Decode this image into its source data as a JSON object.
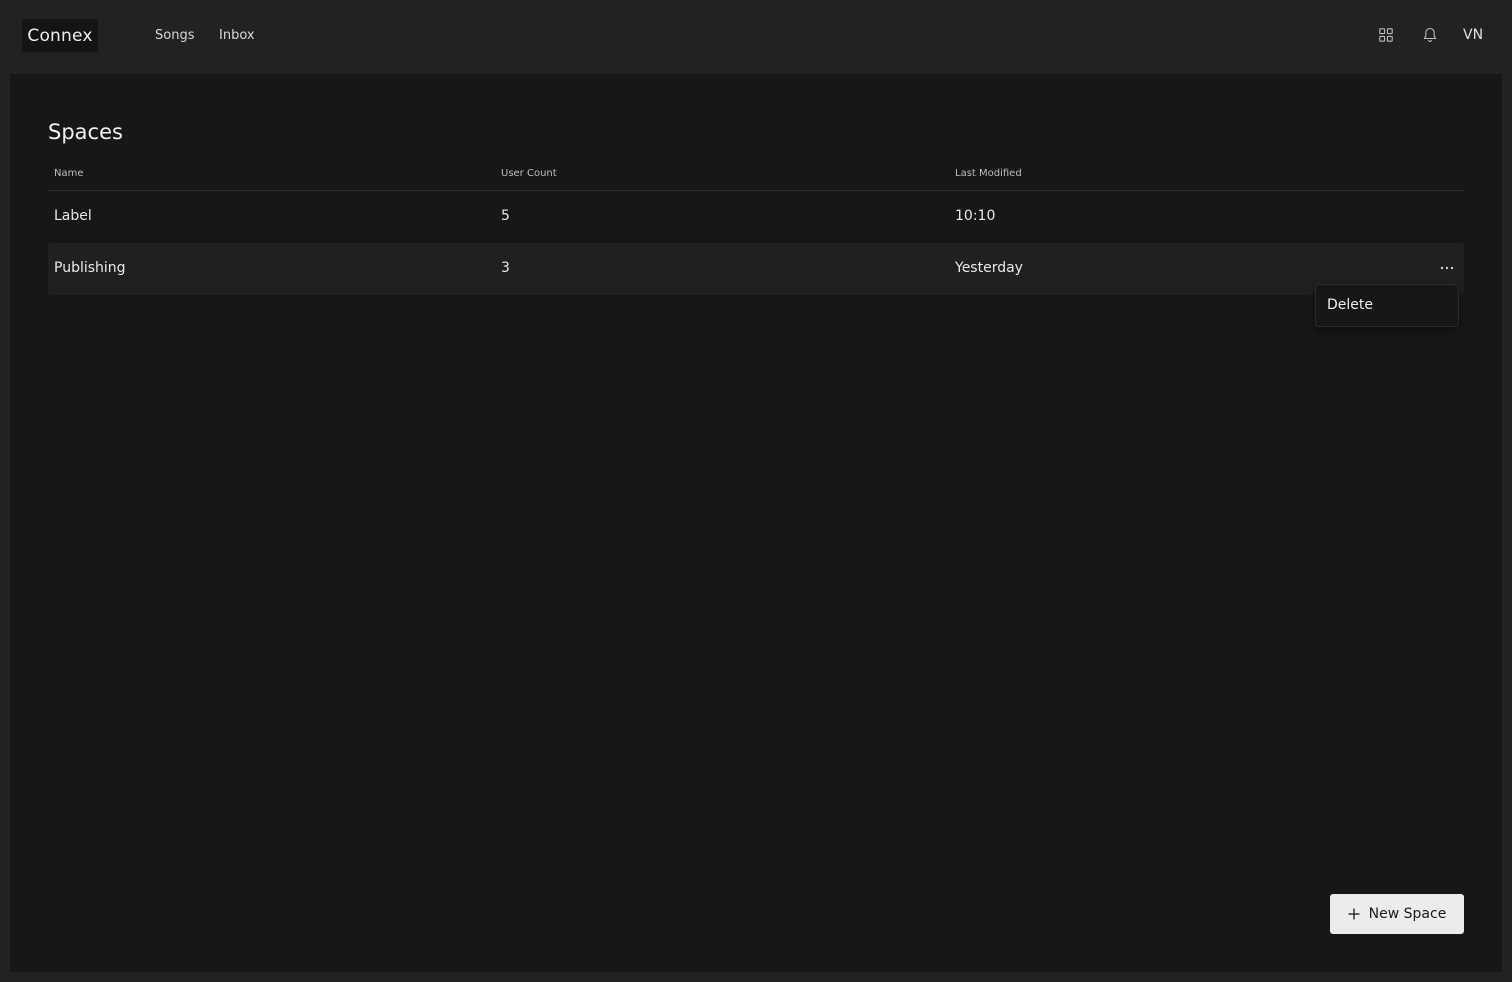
{
  "app": {
    "logo": "Connex"
  },
  "nav": {
    "songs": "Songs",
    "inbox": "Inbox"
  },
  "header": {
    "apps_icon": "grid-icon",
    "notifications_icon": "bell-icon",
    "avatar_initials": "VN"
  },
  "page": {
    "title": "Spaces"
  },
  "table": {
    "headers": {
      "name": "Name",
      "user_count": "User Count",
      "last_modified": "Last Modified"
    },
    "rows": [
      {
        "name": "Label",
        "user_count": "5",
        "last_modified": "10:10"
      },
      {
        "name": "Publishing",
        "user_count": "3",
        "last_modified": "Yesterday"
      }
    ]
  },
  "row_menu": {
    "delete_label": "Delete",
    "more_icon": "more-horizontal-icon"
  },
  "actions": {
    "new_space_label": "New Space",
    "new_space_icon": "plus-icon"
  }
}
